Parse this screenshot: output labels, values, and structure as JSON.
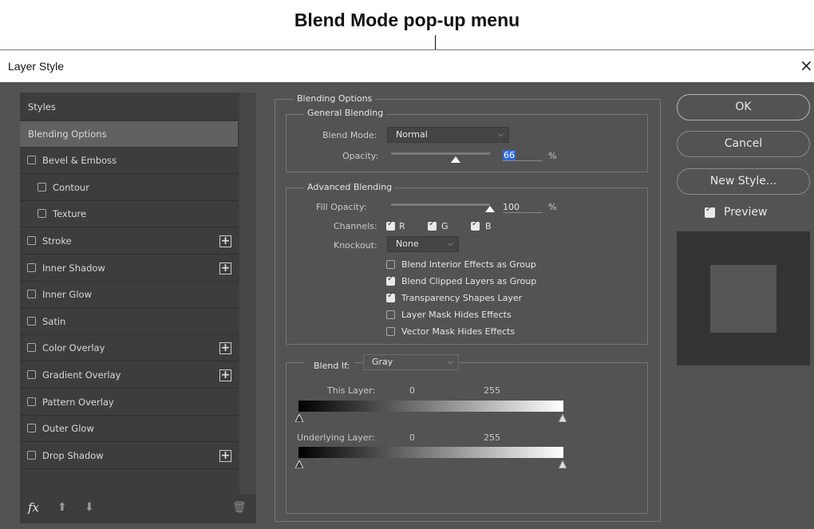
{
  "annotation": "Blend Mode pop-up menu",
  "window": {
    "title": "Layer Style",
    "close_glyph": "×"
  },
  "sidebar": {
    "items": [
      {
        "label": "Styles",
        "checkbox": false,
        "add": false,
        "selected": false
      },
      {
        "label": "Blending Options",
        "checkbox": false,
        "add": false,
        "selected": true
      },
      {
        "label": "Bevel & Emboss",
        "checkbox": true,
        "add": false,
        "selected": false
      },
      {
        "label": "Contour",
        "checkbox": true,
        "add": false,
        "selected": false,
        "sub": true
      },
      {
        "label": "Texture",
        "checkbox": true,
        "add": false,
        "selected": false,
        "sub": true
      },
      {
        "label": "Stroke",
        "checkbox": true,
        "add": true,
        "selected": false
      },
      {
        "label": "Inner Shadow",
        "checkbox": true,
        "add": true,
        "selected": false
      },
      {
        "label": "Inner Glow",
        "checkbox": true,
        "add": false,
        "selected": false
      },
      {
        "label": "Satin",
        "checkbox": true,
        "add": false,
        "selected": false
      },
      {
        "label": "Color Overlay",
        "checkbox": true,
        "add": true,
        "selected": false
      },
      {
        "label": "Gradient Overlay",
        "checkbox": true,
        "add": true,
        "selected": false
      },
      {
        "label": "Pattern Overlay",
        "checkbox": true,
        "add": false,
        "selected": false
      },
      {
        "label": "Outer Glow",
        "checkbox": true,
        "add": false,
        "selected": false
      },
      {
        "label": "Drop Shadow",
        "checkbox": true,
        "add": true,
        "selected": false
      }
    ],
    "fx_label": "fx"
  },
  "blending": {
    "section_title": "Blending Options",
    "general": {
      "title": "General Blending",
      "blend_mode_label": "Blend Mode:",
      "blend_mode_value": "Normal",
      "opacity_label": "Opacity:",
      "opacity_value": "66",
      "opacity_unit": "%"
    },
    "advanced": {
      "title": "Advanced Blending",
      "fill_opacity_label": "Fill Opacity:",
      "fill_opacity_value": "100",
      "fill_opacity_unit": "%",
      "channels_label": "Channels:",
      "channels": [
        {
          "name": "R",
          "checked": true
        },
        {
          "name": "G",
          "checked": true
        },
        {
          "name": "B",
          "checked": true
        }
      ],
      "knockout_label": "Knockout:",
      "knockout_value": "None",
      "options": [
        {
          "label": "Blend Interior Effects as Group",
          "checked": false
        },
        {
          "label": "Blend Clipped Layers as Group",
          "checked": true
        },
        {
          "label": "Transparency Shapes Layer",
          "checked": true
        },
        {
          "label": "Layer Mask Hides Effects",
          "checked": false
        },
        {
          "label": "Vector Mask Hides Effects",
          "checked": false
        }
      ]
    },
    "blend_if": {
      "label": "Blend If:",
      "value": "Gray",
      "this_layer": {
        "label": "This Layer:",
        "low": "0",
        "high": "255"
      },
      "underlying_layer": {
        "label": "Underlying Layer:",
        "low": "0",
        "high": "255"
      }
    }
  },
  "buttons": {
    "ok": "OK",
    "cancel": "Cancel",
    "new_style": "New Style...",
    "preview_label": "Preview",
    "preview_checked": true
  }
}
